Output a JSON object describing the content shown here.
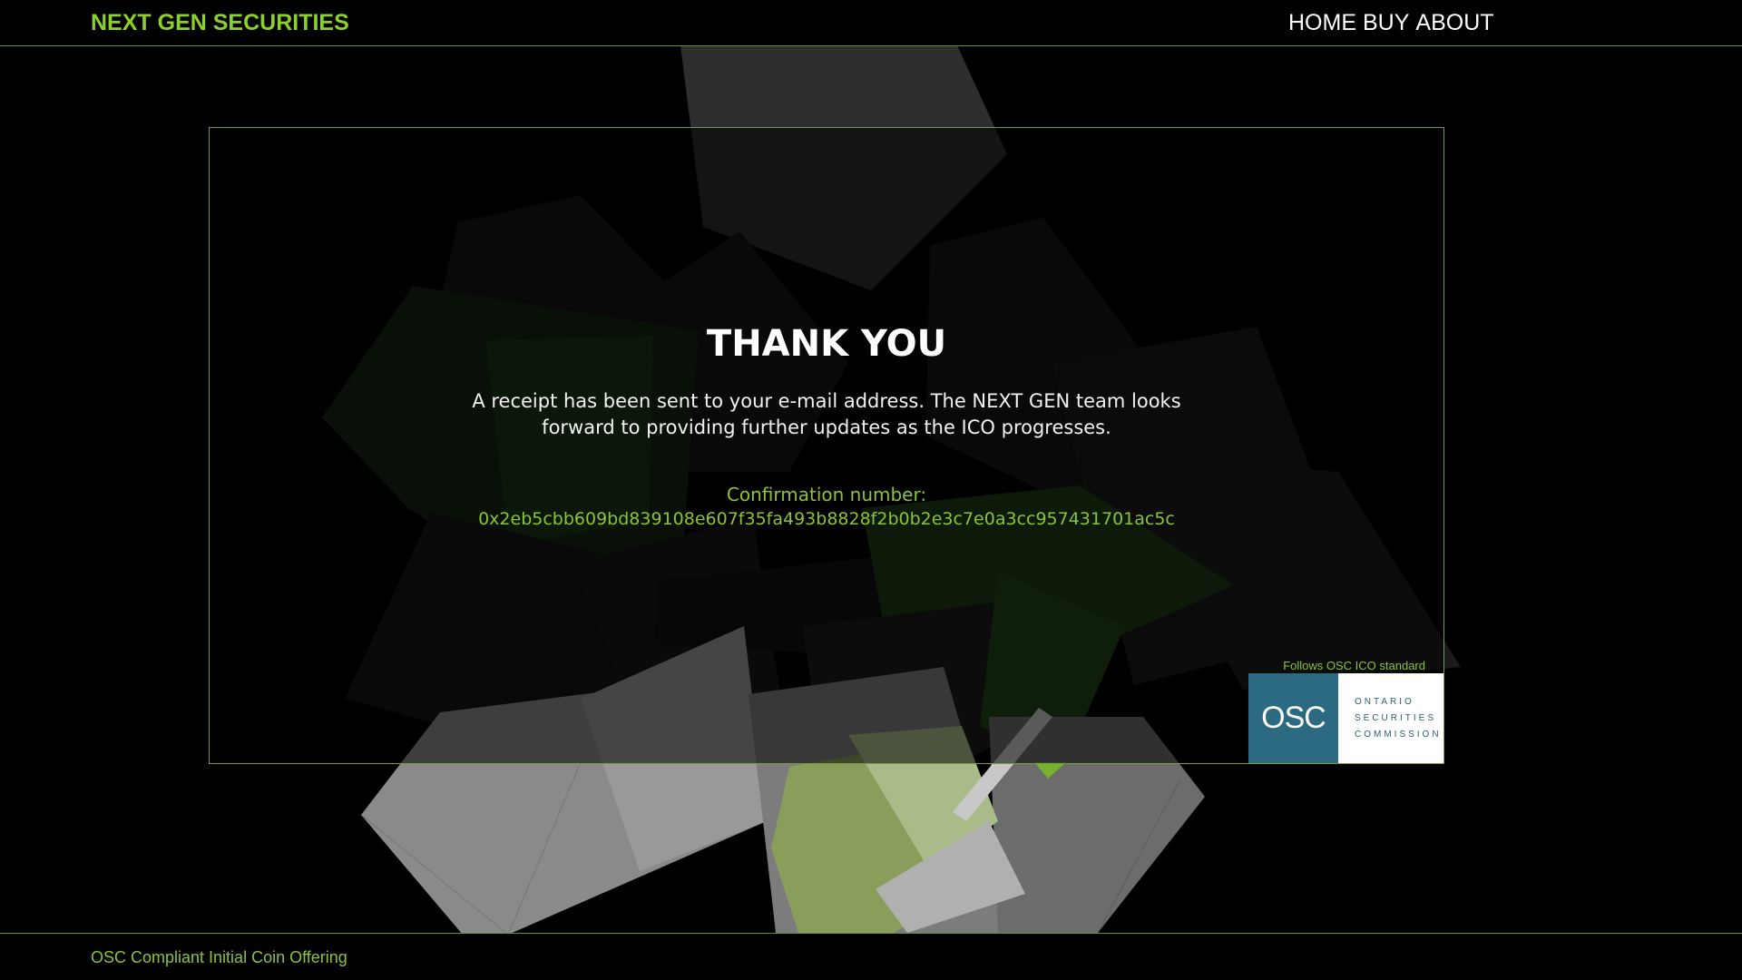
{
  "header": {
    "brand": "NEXT GEN SECURITIES",
    "nav": [
      "HOME",
      "BUY",
      "ABOUT"
    ]
  },
  "main": {
    "title": "THANK YOU",
    "receipt_message": "A receipt has been sent to your e-mail address. The NEXT GEN team looks forward to providing further updates as the ICO progresses.",
    "confirmation_label": "Confirmation number:",
    "confirmation_number": "0x2eb5cbb609bd839108e607f35fa493b8828f2b0b2e3c7e0a3cc957431701ac5c"
  },
  "osc": {
    "caption": "Follows OSC ICO standard",
    "abbr": "OSC",
    "lines": [
      "ONTARIO",
      "SECURITIES",
      "COMMISSION"
    ]
  },
  "footer": {
    "text": "OSC Compliant Initial Coin Offering"
  },
  "colors": {
    "accent": "#8bc33a",
    "brand": "#8bd12a",
    "border": "#7a9a52",
    "osc_blue": "#2b6a80"
  }
}
